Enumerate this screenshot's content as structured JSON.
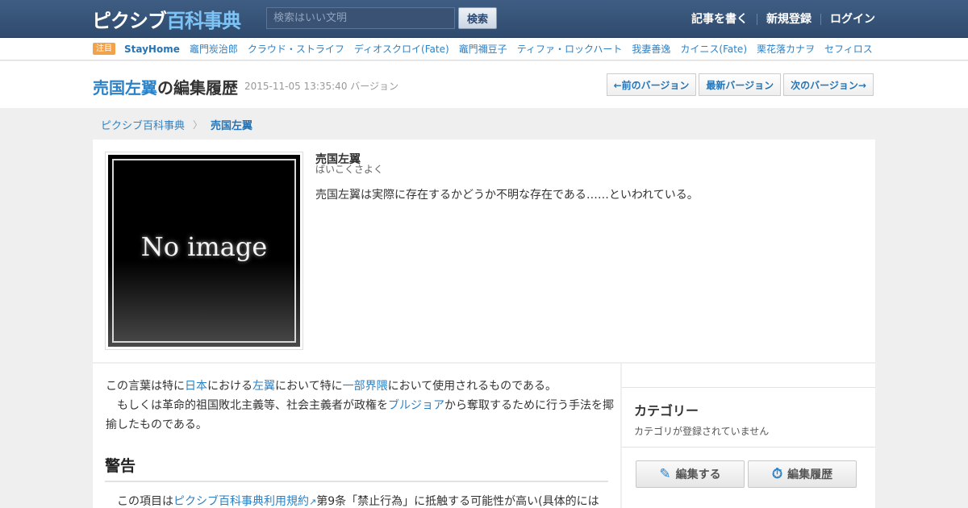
{
  "header": {
    "logo_part1": "ピクシブ",
    "logo_part2": "百科事典",
    "search_placeholder": "検索はいい文明",
    "search_button": "検索",
    "nav": [
      "記事を書く",
      "新規登録",
      "ログイン"
    ]
  },
  "trending": {
    "badge": "注目",
    "items": [
      "StayHome",
      "竈門炭治郎",
      "クラウド・ストライフ",
      "ディオスクロイ(Fate)",
      "竈門禰豆子",
      "ティファ・ロックハート",
      "我妻善逸",
      "カイニス(Fate)",
      "栗花落カナヲ",
      "セフィロス"
    ]
  },
  "titlebar": {
    "title_link": "売国左翼",
    "title_suffix": "の編集履歴",
    "version": "2015-11-05 13:35:40 バージョン",
    "prev": "←前のバージョン",
    "latest": "最新バージョン",
    "next": "次のバージョン→"
  },
  "breadcrumb": {
    "root": "ピクシブ百科事典",
    "sep": "〉",
    "current": "売国左翼"
  },
  "article": {
    "thumb_text": "No image",
    "name": "売国左翼",
    "reading": "ばいこくさよく",
    "summary": "売国左翼は実際に存在するかどうか不明な存在である……といわれている。"
  },
  "body": {
    "p1_a": "この言葉は特に",
    "p1_link1": "日本",
    "p1_b": "における",
    "p1_link2": "左翼",
    "p1_c": "において特に",
    "p1_link3": "一部界隈",
    "p1_d": "において使用されるものである。",
    "p2_a": "　もしくは革命的祖国敗北主義等、社会主義者が政権を",
    "p2_link": "ブルジョア",
    "p2_b": "から奪取するために行う手法を揶揄したものである。",
    "heading": "警告",
    "warn_a": "この項目は",
    "warn_link": "ピクシブ百科事典利用規約",
    "warn_b": "第9条「禁止行為」に抵触する可能性が高い(具体的には"
  },
  "sidebar": {
    "category_title": "カテゴリー",
    "category_empty": "カテゴリが登録されていません",
    "edit_button": "編集する",
    "history_button": "編集履歴"
  }
}
